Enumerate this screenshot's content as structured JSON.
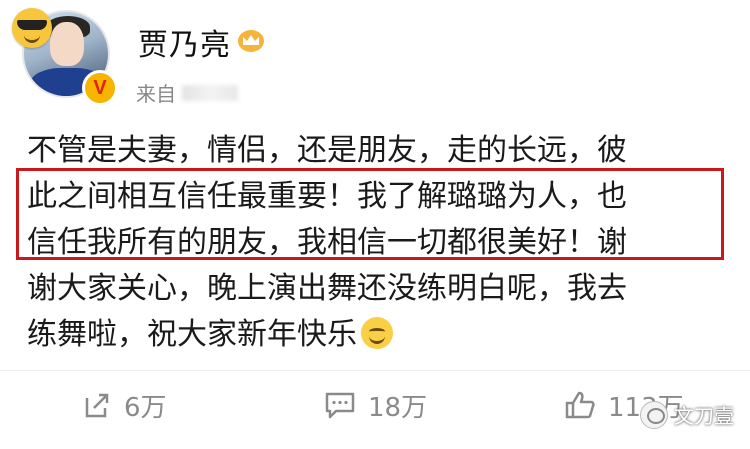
{
  "profile": {
    "username": "贾乃亮",
    "source_prefix": "来自",
    "badges": [
      "sunglasses-emoji-badge",
      "verified-badge",
      "crown-vip-badge"
    ]
  },
  "post": {
    "lines": [
      "不管是夫妻，情侣，还是朋友，走的长远，彼",
      "此之间相互信任最重要！我了解璐璐为人，也",
      "信任我所有的朋友，我相信一切都很美好！谢",
      "谢大家关心，晚上演出舞还没练明白呢，我去",
      "练舞啦，祝大家新年快乐"
    ],
    "trailing_emoji": "smile-emoji"
  },
  "actions": {
    "share_count": "6万",
    "comment_count": "18万",
    "like_count": "113万"
  },
  "watermark": {
    "text": "文刀壹"
  },
  "colors": {
    "highlight_border": "#c8191e",
    "action_gray": "#8a8a8a",
    "verify_badge": "#f7b500"
  }
}
